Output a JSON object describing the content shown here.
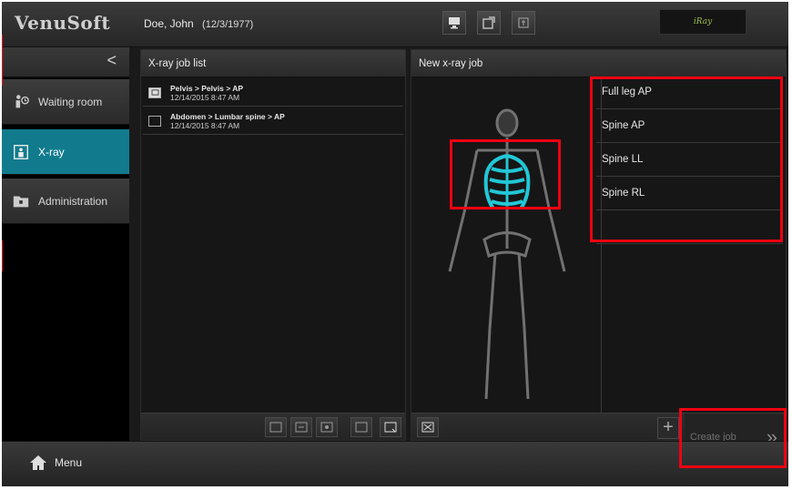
{
  "app": {
    "brand": "VenuSoft",
    "logo_text": "iRay"
  },
  "patient": {
    "name": "Doe, John",
    "dob": "(12/3/1977)"
  },
  "header_icons": [
    "monitor-icon",
    "export-icon",
    "settings-icon"
  ],
  "nav": {
    "collapse_glyph": "<",
    "items": [
      {
        "label": "Waiting room",
        "icon": "waiting-room-icon",
        "active": false
      },
      {
        "label": "X-ray",
        "icon": "xray-icon",
        "active": true
      },
      {
        "label": "Administration",
        "icon": "folder-icon",
        "active": false
      }
    ]
  },
  "job_list": {
    "title": "X-ray job list",
    "jobs": [
      {
        "path": "Pelvis > Pelvis > AP",
        "datetime": "12/14/2015 8:47 AM"
      },
      {
        "path": "Abdomen > Lumbar spine > AP",
        "datetime": "12/14/2015 8:47 AM"
      }
    ],
    "toolbar_icons": [
      "job-icon-1",
      "job-icon-2",
      "job-icon-3",
      "job-icon-4",
      "job-icon-5"
    ]
  },
  "new_job": {
    "title": "New x-ray job",
    "exams": [
      "Full leg AP",
      "Spine AP",
      "Spine LL",
      "Spine RL",
      ""
    ],
    "plus": "+",
    "create_label": "Create job",
    "create_arrow": "»"
  },
  "footer": {
    "menu_label": "Menu"
  },
  "colors": {
    "accent": "#117b8d",
    "highlight": "#e01010",
    "ribcage": "#22c7d6"
  }
}
